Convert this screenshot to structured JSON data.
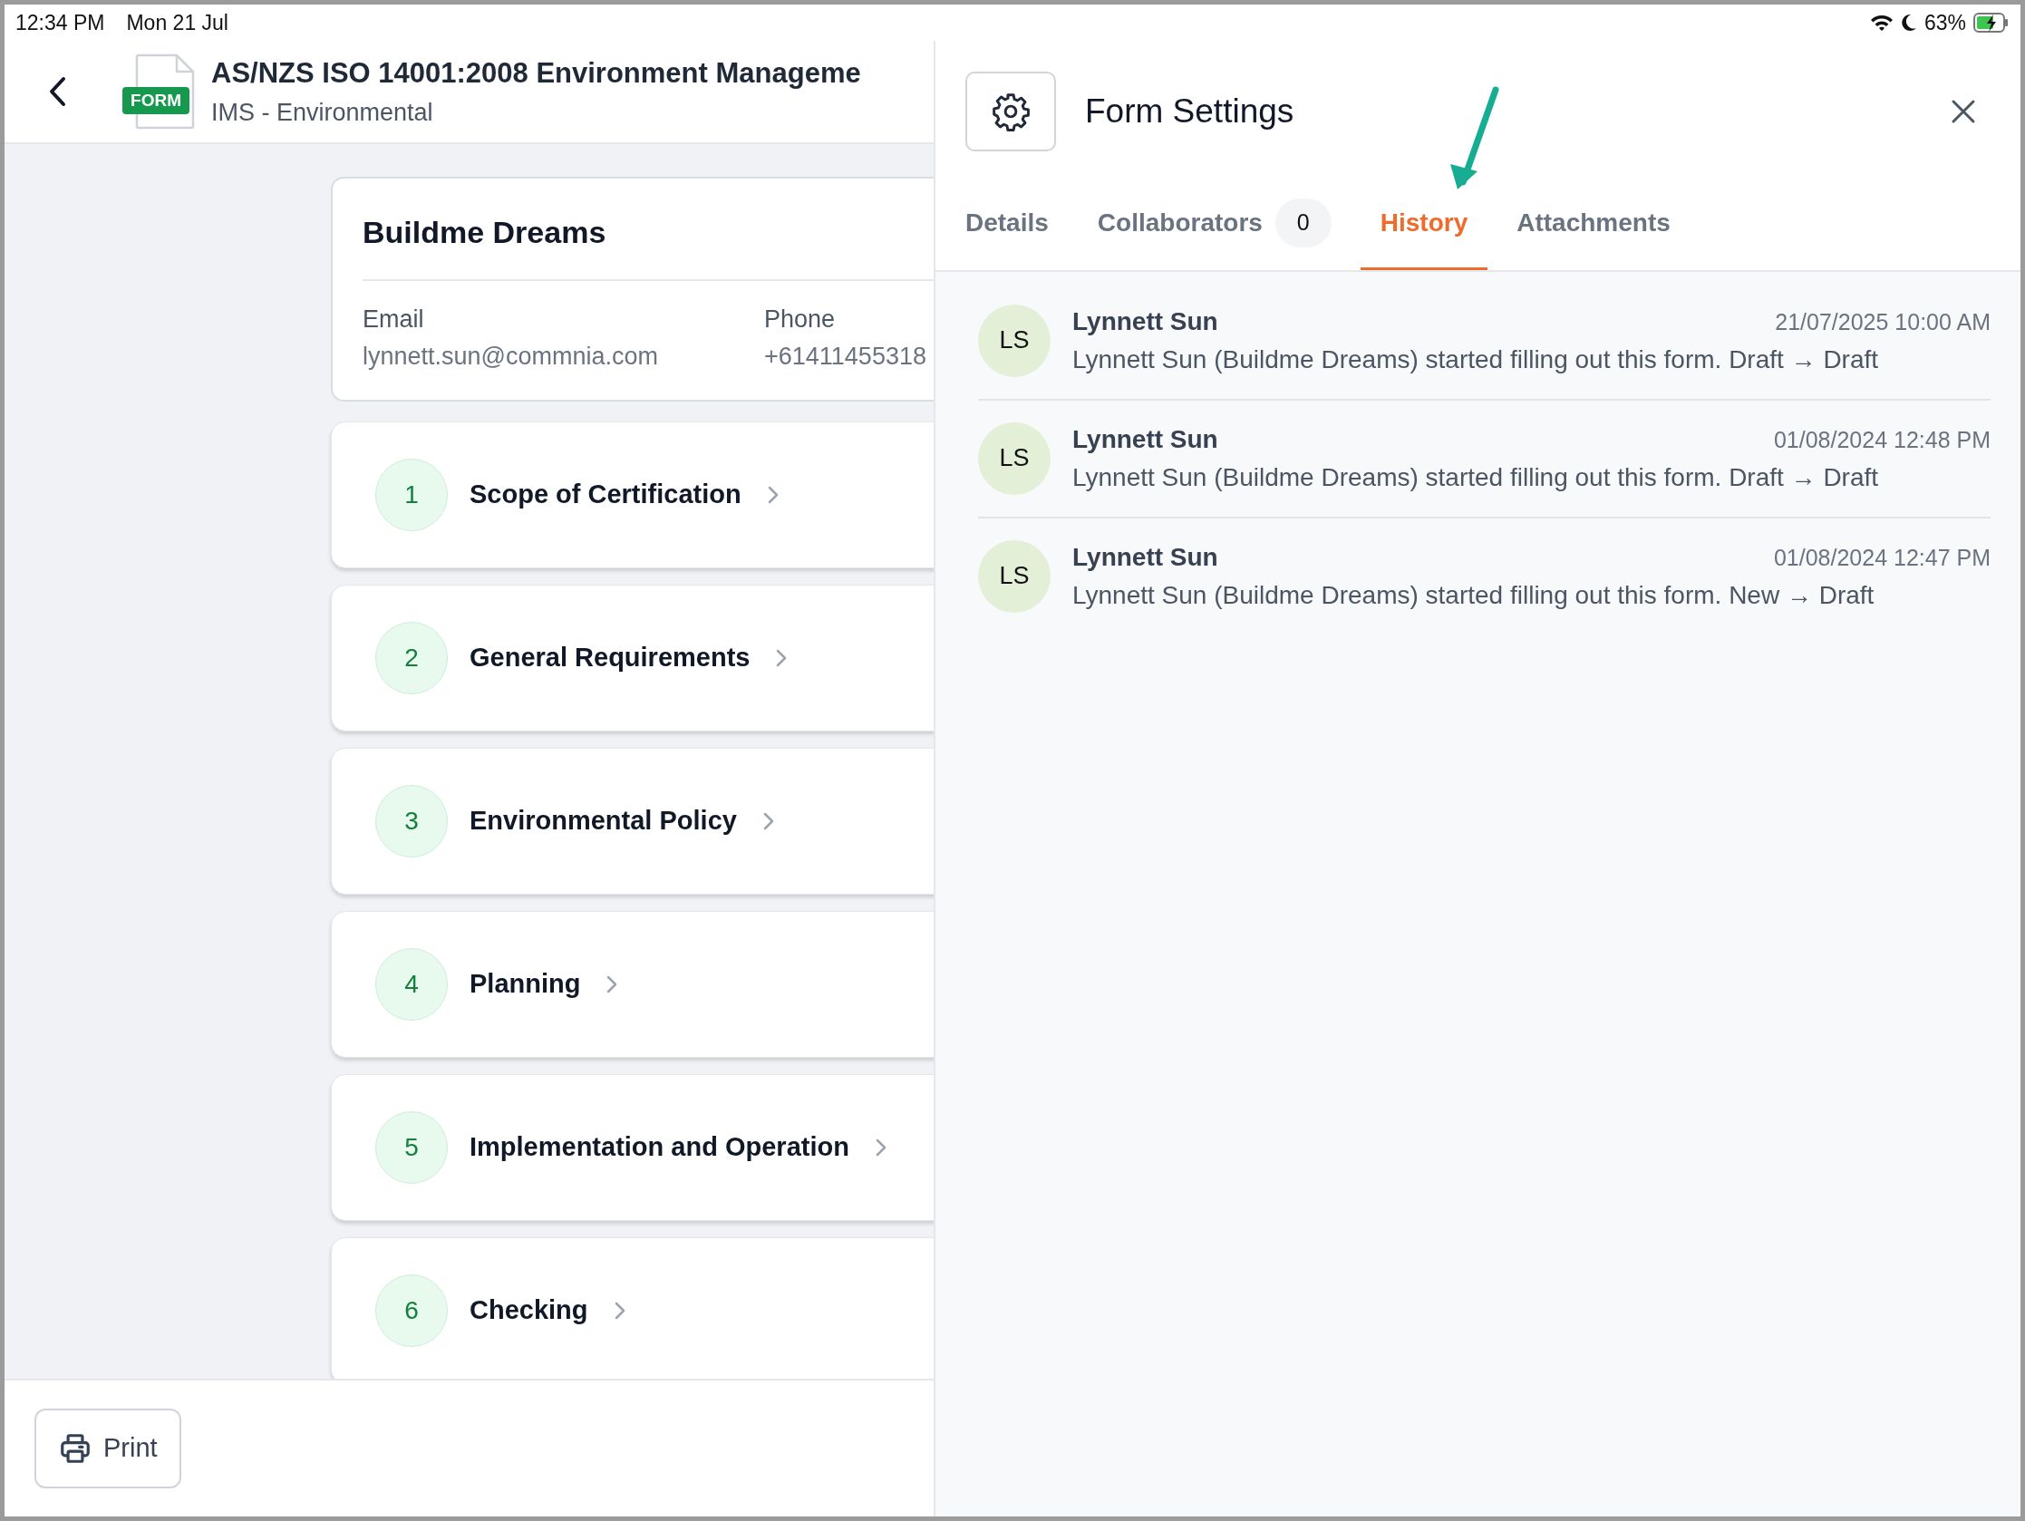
{
  "status_bar": {
    "time": "12:34 PM",
    "date": "Mon 21 Jul",
    "battery": "63%"
  },
  "header": {
    "title": "AS/NZS ISO 14001:2008 Environment Manageme",
    "subtitle": "IMS - Environmental",
    "badge": "FORM"
  },
  "company": {
    "name": "Buildme Dreams",
    "fields": [
      {
        "label": "Email",
        "value": "lynnett.sun@commnia.com"
      },
      {
        "label": "Phone",
        "value": "+61411455318"
      }
    ]
  },
  "sections": [
    {
      "number": "1",
      "title": "Scope of Certification"
    },
    {
      "number": "2",
      "title": "General Requirements"
    },
    {
      "number": "3",
      "title": "Environmental Policy"
    },
    {
      "number": "4",
      "title": "Planning"
    },
    {
      "number": "5",
      "title": "Implementation and Operation"
    },
    {
      "number": "6",
      "title": "Checking"
    }
  ],
  "footer": {
    "print_button": "Print"
  },
  "panel": {
    "title": "Form Settings",
    "tabs": [
      {
        "label": "Details",
        "selected": false
      },
      {
        "label": "Collaborators",
        "count": "0",
        "selected": false
      },
      {
        "label": "History",
        "selected": true
      },
      {
        "label": "Attachments",
        "selected": false
      }
    ],
    "history": [
      {
        "initials": "LS",
        "name": "Lynnett Sun",
        "time": "21/07/2025 10:00 AM",
        "text": "Lynnett Sun (Buildme Dreams) started filling out this form. Draft → Draft"
      },
      {
        "initials": "LS",
        "name": "Lynnett Sun",
        "time": "01/08/2024 12:48 PM",
        "text": "Lynnett Sun (Buildme Dreams) started filling out this form. Draft → Draft"
      },
      {
        "initials": "LS",
        "name": "Lynnett Sun",
        "time": "01/08/2024 12:47 PM",
        "text": "Lynnett Sun (Buildme Dreams) started filling out this form. New → Draft"
      }
    ]
  }
}
